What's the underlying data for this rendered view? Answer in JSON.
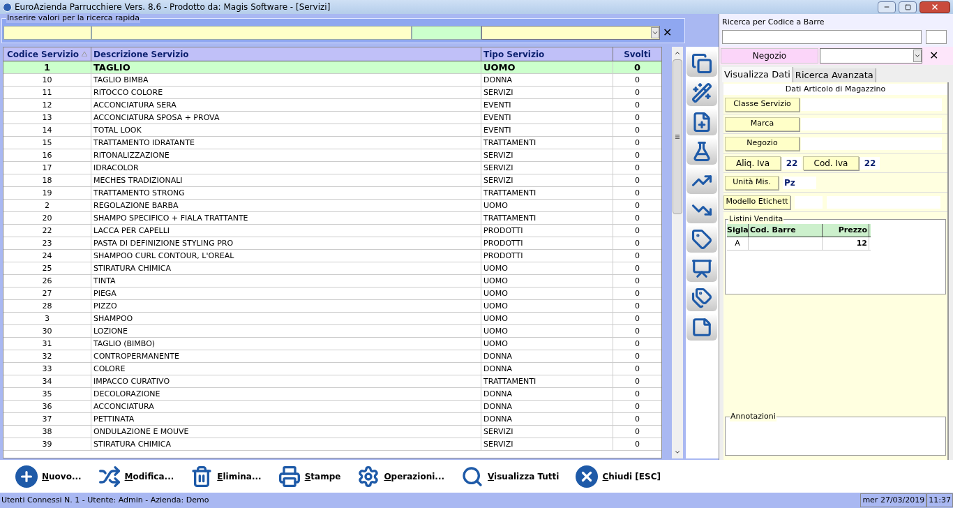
{
  "window": {
    "title": "EuroAzienda Parrucchiere Vers. 8.6 - Prodotto da: Magis Software - [Servizi]"
  },
  "quick_search": {
    "legend": "Inserire valori per la ricerca rapida",
    "clear": "✕"
  },
  "table": {
    "columns": [
      {
        "label": "Codice Servizio",
        "sorted": true
      },
      {
        "label": "Descrizione Servizio",
        "sorted": false
      },
      {
        "label": "Tipo Servizio",
        "sorted": false
      },
      {
        "label": "Svolti",
        "sorted": false
      }
    ],
    "rows": [
      {
        "cells": [
          "1",
          "TAGLIO",
          "UOMO",
          "0"
        ],
        "selected": true
      },
      {
        "cells": [
          "10",
          "TAGLIO BIMBA",
          "DONNA",
          "0"
        ],
        "selected": false
      },
      {
        "cells": [
          "11",
          "RITOCCO COLORE",
          "SERVIZI",
          "0"
        ],
        "selected": false
      },
      {
        "cells": [
          "12",
          "ACCONCIATURA SERA",
          "EVENTI",
          "0"
        ],
        "selected": false
      },
      {
        "cells": [
          "13",
          "ACCONCIATURA SPOSA + PROVA",
          "EVENTI",
          "0"
        ],
        "selected": false
      },
      {
        "cells": [
          "14",
          "TOTAL LOOK",
          "EVENTI",
          "0"
        ],
        "selected": false
      },
      {
        "cells": [
          "15",
          "TRATTAMENTO IDRATANTE",
          "TRATTAMENTI",
          "0"
        ],
        "selected": false
      },
      {
        "cells": [
          "16",
          "RITONALIZZAZIONE",
          "SERVIZI",
          "0"
        ],
        "selected": false
      },
      {
        "cells": [
          "17",
          "IDRACOLOR",
          "SERVIZI",
          "0"
        ],
        "selected": false
      },
      {
        "cells": [
          "18",
          "MECHES TRADIZIONALI",
          "SERVIZI",
          "0"
        ],
        "selected": false
      },
      {
        "cells": [
          "19",
          "TRATTAMENTO STRONG",
          "TRATTAMENTI",
          "0"
        ],
        "selected": false
      },
      {
        "cells": [
          "2",
          "REGOLAZIONE BARBA",
          "UOMO",
          "0"
        ],
        "selected": false
      },
      {
        "cells": [
          "20",
          "SHAMPO SPECIFICO + FIALA TRATTANTE",
          "TRATTAMENTI",
          "0"
        ],
        "selected": false
      },
      {
        "cells": [
          "22",
          "LACCA PER CAPELLI",
          "PRODOTTI",
          "0"
        ],
        "selected": false
      },
      {
        "cells": [
          "23",
          "PASTA DI DEFINIZIONE STYLING PRO",
          "PRODOTTI",
          "0"
        ],
        "selected": false
      },
      {
        "cells": [
          "24",
          "SHAMPOO CURL CONTOUR, L'OREAL",
          "PRODOTTI",
          "0"
        ],
        "selected": false
      },
      {
        "cells": [
          "25",
          "STIRATURA CHIMICA",
          "UOMO",
          "0"
        ],
        "selected": false
      },
      {
        "cells": [
          "26",
          "TINTA",
          "UOMO",
          "0"
        ],
        "selected": false
      },
      {
        "cells": [
          "27",
          "PIEGA",
          "UOMO",
          "0"
        ],
        "selected": false
      },
      {
        "cells": [
          "28",
          "PIZZO",
          "UOMO",
          "0"
        ],
        "selected": false
      },
      {
        "cells": [
          "3",
          "SHAMPOO",
          "UOMO",
          "0"
        ],
        "selected": false
      },
      {
        "cells": [
          "30",
          "LOZIONE",
          "UOMO",
          "0"
        ],
        "selected": false
      },
      {
        "cells": [
          "31",
          "TAGLIO (BIMBO)",
          "UOMO",
          "0"
        ],
        "selected": false
      },
      {
        "cells": [
          "32",
          "CONTROPERMANENTE",
          "DONNA",
          "0"
        ],
        "selected": false
      },
      {
        "cells": [
          "33",
          "COLORE",
          "DONNA",
          "0"
        ],
        "selected": false
      },
      {
        "cells": [
          "34",
          "IMPACCO CURATIVO",
          "TRATTAMENTI",
          "0"
        ],
        "selected": false
      },
      {
        "cells": [
          "35",
          "DECOLORAZIONE",
          "DONNA",
          "0"
        ],
        "selected": false
      },
      {
        "cells": [
          "36",
          "ACCONCIATURA",
          "DONNA",
          "0"
        ],
        "selected": false
      },
      {
        "cells": [
          "37",
          "PETTINATA",
          "DONNA",
          "0"
        ],
        "selected": false
      },
      {
        "cells": [
          "38",
          "ONDULAZIONE E MOUVE",
          "SERVIZI",
          "0"
        ],
        "selected": false
      },
      {
        "cells": [
          "39",
          "STIRATURA CHIMICA",
          "SERVIZI",
          "0"
        ],
        "selected": false
      }
    ]
  },
  "side_tools": [
    {
      "kind": "folders"
    },
    {
      "kind": "wand"
    },
    {
      "kind": "newdoc"
    },
    {
      "kind": "flask"
    },
    {
      "kind": "up"
    },
    {
      "kind": "down"
    },
    {
      "kind": "tag"
    },
    {
      "kind": "chart"
    },
    {
      "kind": "tags"
    },
    {
      "kind": "note"
    }
  ],
  "barcode": {
    "label": "Ricerca per Codice a Barre"
  },
  "shop_filter": {
    "label": "Negozio",
    "clear": "✕"
  },
  "tabs": [
    {
      "label": "Visualizza Dati",
      "selected": true
    },
    {
      "label": "Ricerca Avanzata",
      "selected": false
    }
  ],
  "details": {
    "title": "Dati Articolo di Magazzino",
    "classe": "Classe Servizio",
    "marca": "Marca",
    "negozio": "Negozio",
    "aliq_label": "Aliq. Iva",
    "aliq_value": "22",
    "cod_label": "Cod. Iva",
    "cod_value": "22",
    "unita_label": "Unità Mis.",
    "unita_value": "Pz",
    "modello_label": "Modello Etichett"
  },
  "price_lists": {
    "legend": "Listini Vendita",
    "columns": [
      "Sigla",
      "Cod. Barre",
      "Prezzo"
    ],
    "rows": [
      [
        "A",
        "",
        "12"
      ]
    ]
  },
  "notes": {
    "legend": "Annotazioni"
  },
  "toolbar": [
    {
      "kind": "plus",
      "label": "Nuovo..."
    },
    {
      "kind": "shuffle",
      "label": "Modifica..."
    },
    {
      "kind": "trash",
      "label": "Elimina..."
    },
    {
      "kind": "print",
      "label": "Stampe"
    },
    {
      "kind": "gear",
      "label": "Operazioni..."
    },
    {
      "kind": "search",
      "label": "Visualizza Tutti"
    },
    {
      "kind": "close",
      "label": "Chiudi [ESC]"
    }
  ],
  "status_bar": {
    "info": "Utenti Connessi N. 1 - Utente: Admin - Azienda: Demo",
    "date": "mer 27/03/2019",
    "time": "11:37"
  }
}
